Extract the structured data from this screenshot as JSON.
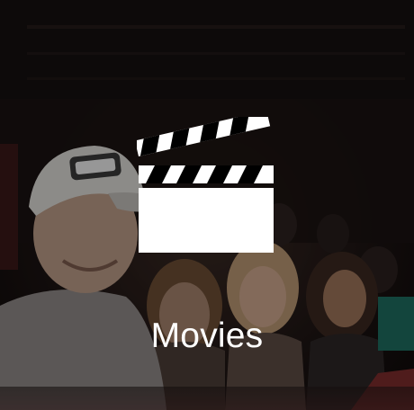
{
  "tile": {
    "label": "Movies",
    "icon": "clapperboard-icon",
    "background_image": "crowd-in-theater-photo"
  },
  "colors": {
    "text": "#ffffff",
    "overlay": "#000000"
  }
}
